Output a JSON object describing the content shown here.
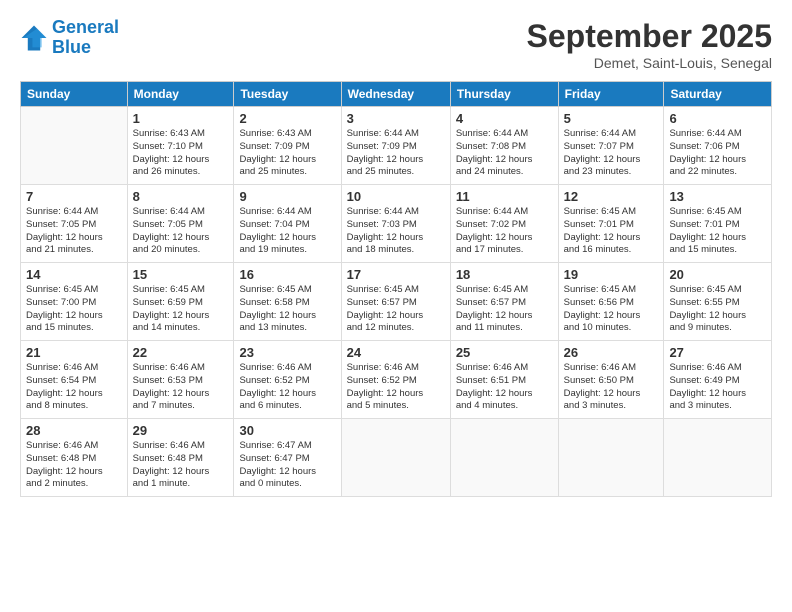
{
  "logo": {
    "line1": "General",
    "line2": "Blue"
  },
  "header": {
    "month": "September 2025",
    "location": "Demet, Saint-Louis, Senegal"
  },
  "weekdays": [
    "Sunday",
    "Monday",
    "Tuesday",
    "Wednesday",
    "Thursday",
    "Friday",
    "Saturday"
  ],
  "weeks": [
    [
      {
        "day": "",
        "info": ""
      },
      {
        "day": "1",
        "info": "Sunrise: 6:43 AM\nSunset: 7:10 PM\nDaylight: 12 hours\nand 26 minutes."
      },
      {
        "day": "2",
        "info": "Sunrise: 6:43 AM\nSunset: 7:09 PM\nDaylight: 12 hours\nand 25 minutes."
      },
      {
        "day": "3",
        "info": "Sunrise: 6:44 AM\nSunset: 7:09 PM\nDaylight: 12 hours\nand 25 minutes."
      },
      {
        "day": "4",
        "info": "Sunrise: 6:44 AM\nSunset: 7:08 PM\nDaylight: 12 hours\nand 24 minutes."
      },
      {
        "day": "5",
        "info": "Sunrise: 6:44 AM\nSunset: 7:07 PM\nDaylight: 12 hours\nand 23 minutes."
      },
      {
        "day": "6",
        "info": "Sunrise: 6:44 AM\nSunset: 7:06 PM\nDaylight: 12 hours\nand 22 minutes."
      }
    ],
    [
      {
        "day": "7",
        "info": "Sunrise: 6:44 AM\nSunset: 7:05 PM\nDaylight: 12 hours\nand 21 minutes."
      },
      {
        "day": "8",
        "info": "Sunrise: 6:44 AM\nSunset: 7:05 PM\nDaylight: 12 hours\nand 20 minutes."
      },
      {
        "day": "9",
        "info": "Sunrise: 6:44 AM\nSunset: 7:04 PM\nDaylight: 12 hours\nand 19 minutes."
      },
      {
        "day": "10",
        "info": "Sunrise: 6:44 AM\nSunset: 7:03 PM\nDaylight: 12 hours\nand 18 minutes."
      },
      {
        "day": "11",
        "info": "Sunrise: 6:44 AM\nSunset: 7:02 PM\nDaylight: 12 hours\nand 17 minutes."
      },
      {
        "day": "12",
        "info": "Sunrise: 6:45 AM\nSunset: 7:01 PM\nDaylight: 12 hours\nand 16 minutes."
      },
      {
        "day": "13",
        "info": "Sunrise: 6:45 AM\nSunset: 7:01 PM\nDaylight: 12 hours\nand 15 minutes."
      }
    ],
    [
      {
        "day": "14",
        "info": "Sunrise: 6:45 AM\nSunset: 7:00 PM\nDaylight: 12 hours\nand 15 minutes."
      },
      {
        "day": "15",
        "info": "Sunrise: 6:45 AM\nSunset: 6:59 PM\nDaylight: 12 hours\nand 14 minutes."
      },
      {
        "day": "16",
        "info": "Sunrise: 6:45 AM\nSunset: 6:58 PM\nDaylight: 12 hours\nand 13 minutes."
      },
      {
        "day": "17",
        "info": "Sunrise: 6:45 AM\nSunset: 6:57 PM\nDaylight: 12 hours\nand 12 minutes."
      },
      {
        "day": "18",
        "info": "Sunrise: 6:45 AM\nSunset: 6:57 PM\nDaylight: 12 hours\nand 11 minutes."
      },
      {
        "day": "19",
        "info": "Sunrise: 6:45 AM\nSunset: 6:56 PM\nDaylight: 12 hours\nand 10 minutes."
      },
      {
        "day": "20",
        "info": "Sunrise: 6:45 AM\nSunset: 6:55 PM\nDaylight: 12 hours\nand 9 minutes."
      }
    ],
    [
      {
        "day": "21",
        "info": "Sunrise: 6:46 AM\nSunset: 6:54 PM\nDaylight: 12 hours\nand 8 minutes."
      },
      {
        "day": "22",
        "info": "Sunrise: 6:46 AM\nSunset: 6:53 PM\nDaylight: 12 hours\nand 7 minutes."
      },
      {
        "day": "23",
        "info": "Sunrise: 6:46 AM\nSunset: 6:52 PM\nDaylight: 12 hours\nand 6 minutes."
      },
      {
        "day": "24",
        "info": "Sunrise: 6:46 AM\nSunset: 6:52 PM\nDaylight: 12 hours\nand 5 minutes."
      },
      {
        "day": "25",
        "info": "Sunrise: 6:46 AM\nSunset: 6:51 PM\nDaylight: 12 hours\nand 4 minutes."
      },
      {
        "day": "26",
        "info": "Sunrise: 6:46 AM\nSunset: 6:50 PM\nDaylight: 12 hours\nand 3 minutes."
      },
      {
        "day": "27",
        "info": "Sunrise: 6:46 AM\nSunset: 6:49 PM\nDaylight: 12 hours\nand 3 minutes."
      }
    ],
    [
      {
        "day": "28",
        "info": "Sunrise: 6:46 AM\nSunset: 6:48 PM\nDaylight: 12 hours\nand 2 minutes."
      },
      {
        "day": "29",
        "info": "Sunrise: 6:46 AM\nSunset: 6:48 PM\nDaylight: 12 hours\nand 1 minute."
      },
      {
        "day": "30",
        "info": "Sunrise: 6:47 AM\nSunset: 6:47 PM\nDaylight: 12 hours\nand 0 minutes."
      },
      {
        "day": "",
        "info": ""
      },
      {
        "day": "",
        "info": ""
      },
      {
        "day": "",
        "info": ""
      },
      {
        "day": "",
        "info": ""
      }
    ]
  ]
}
